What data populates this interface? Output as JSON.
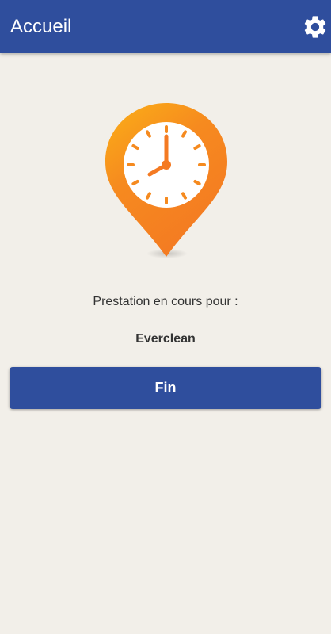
{
  "app_bar": {
    "title": "Accueil",
    "settings_icon": "gear-icon",
    "color": "#2f4e9d"
  },
  "hero": {
    "icon": "location-clock-icon",
    "gradient_start": "#fbb017",
    "gradient_end": "#f47a22"
  },
  "main": {
    "status_label": "Prestation en cours pour :",
    "client_name": "Everclean",
    "end_button_label": "Fin"
  }
}
